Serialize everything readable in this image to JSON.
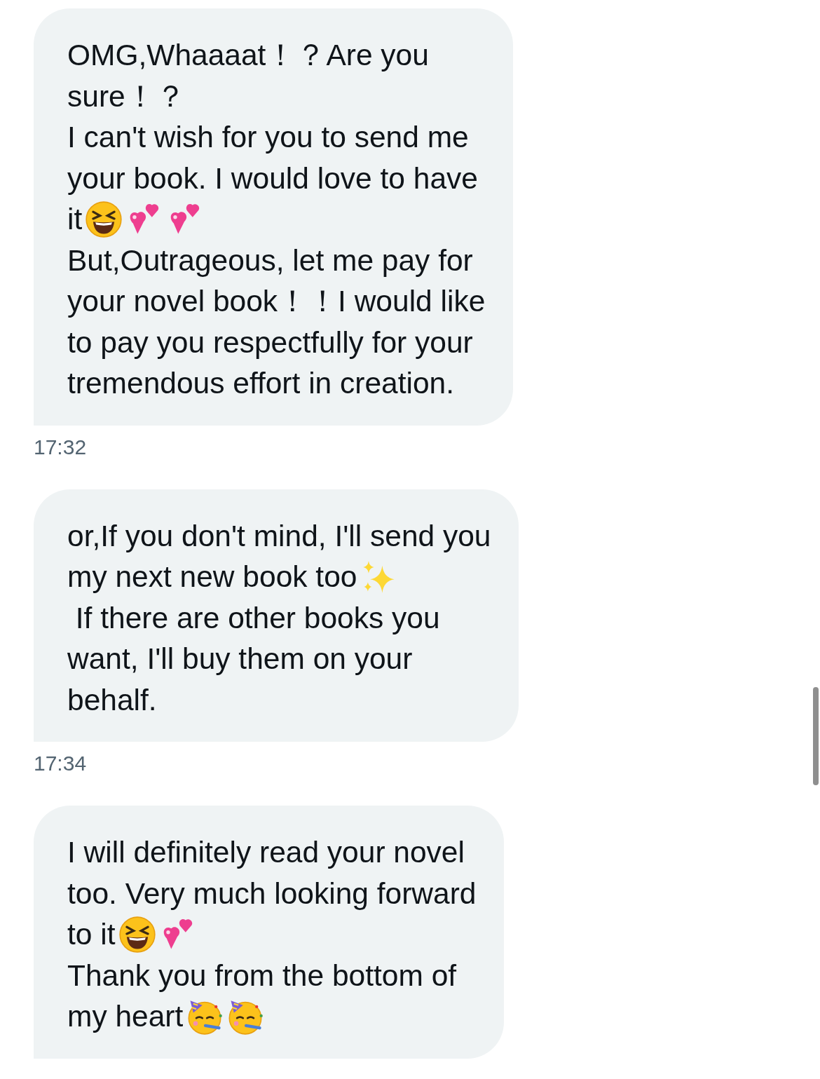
{
  "messages": [
    {
      "lines": [
        "OMG,Whaaaat！？Are you",
        "sure！？",
        "I can't wish for you to send me",
        "your book. I would love to have",
        {
          "text": "it",
          "emoji": [
            {
              "kind": "laughing"
            },
            {
              "kind": "hearts"
            },
            {
              "kind": "hearts"
            }
          ]
        },
        "But,Outrageous, let me pay for",
        "your novel book！！I would like",
        "to pay you respectfully for your",
        "tremendous effort in creation."
      ],
      "time": "17:32"
    },
    {
      "lines": [
        "or,If you don't mind, I'll send you",
        {
          "text": "my next new book too",
          "emoji": [
            {
              "kind": "sparkles"
            }
          ]
        },
        " If there are other books you",
        "want, I'll buy them on your",
        "behalf."
      ],
      "time": "17:34"
    },
    {
      "lines": [
        "I will definitely read your novel",
        "too. Very much looking forward",
        {
          "text": "to it",
          "emoji": [
            {
              "kind": "laughing"
            },
            {
              "kind": "hearts"
            }
          ]
        },
        "Thank you from the bottom of",
        {
          "text": "my heart",
          "emoji": [
            {
              "kind": "party"
            },
            {
              "kind": "party"
            }
          ]
        }
      ]
    }
  ]
}
